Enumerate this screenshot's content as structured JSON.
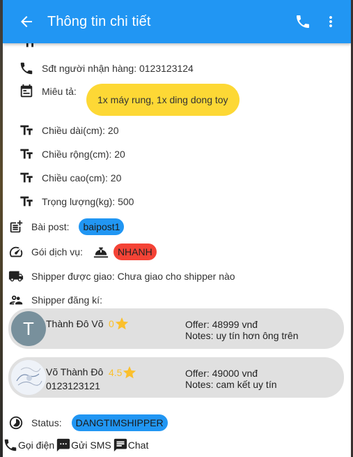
{
  "appbar": {
    "title": "Thông tin chi tiết"
  },
  "details": {
    "phone_label": "Sđt người nhận hàng: 0123123124",
    "description_label": "Miêu tả:",
    "description_value": "1x máy rung, 1x ding dong toy",
    "length": "Chiều dài(cm): 20",
    "width": "Chiều rộng(cm): 20",
    "height": "Chiều cao(cm): 20",
    "weight": "Trọng lượng(kg): 500",
    "post_label": "Bài post:",
    "post_value": "baipost1",
    "service_label": "Gói dịch vụ:",
    "service_value": "NHANH",
    "shipper_assigned": "Shipper được giao: Chưa giao cho shipper nào",
    "shipper_registered_label": "Shipper đăng kí:"
  },
  "shippers": [
    {
      "avatar_letter": "T",
      "name": "Thành Đô Võ",
      "phone": "",
      "rating": "0",
      "offer": "Offer: 48999 vnđ",
      "notes": "Notes: uy tín hơn ông trên"
    },
    {
      "avatar_letter": "",
      "name": "Võ Thành Đô",
      "phone": "0123123121",
      "rating": "4.5",
      "offer": "Offer: 49000 vnđ",
      "notes": "Notes: cam kết uy tín"
    }
  ],
  "status": {
    "label": "Status:",
    "value": "DANGTIMSHIPPER"
  },
  "actions": {
    "call": "Gọi điện",
    "sms": "Gửi SMS",
    "chat": "Chat"
  },
  "colors": {
    "primary": "#2196f3",
    "danger": "#f44336",
    "highlight": "#fdd835",
    "star": "#fbc02d",
    "card": "#e0e0e0"
  }
}
